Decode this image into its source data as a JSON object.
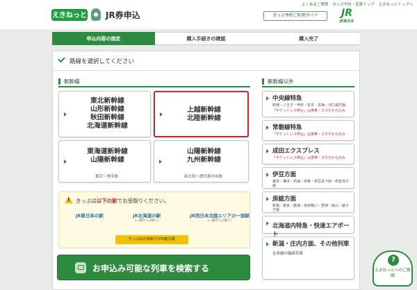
{
  "header": {
    "top_links": [
      "よくあるご質問",
      "きっぷ予約・変更トップ",
      "えきねっとトップへ"
    ],
    "logo": "えきねっと",
    "title": "JR券申込",
    "guide_button": "きっぷ予約ご利用ガイド",
    "jr_logo": "JR",
    "jr_sub": "JR東日本"
  },
  "steps": [
    "申込内容の指定",
    "購入手続きの確認",
    "購入完了"
  ],
  "route": {
    "heading": "路線を選択してください"
  },
  "shinkansen": {
    "section_title": "新幹線",
    "buttons": [
      {
        "lines": "東北新幹線\n山形新幹線\n秋田新幹線\n北海道新幹線",
        "sub": ""
      },
      {
        "lines": "上越新幹線\n北陸新幹線",
        "sub": ""
      },
      {
        "lines": "東海道新幹線\n山陽新幹線",
        "sub": "東京〜博多間"
      },
      {
        "lines": "山陽新幹線\n九州新幹線",
        "sub": "新大阪〜鹿児島中央間"
      }
    ]
  },
  "notice": {
    "text_prefix": "きっぷは",
    "text_red": "以下の駅",
    "text_suffix": "でお受取りください。",
    "stations": [
      {
        "name": "JR東日本の駅",
        "note": ""
      },
      {
        "name": "JR北海道の駅",
        "note": "（一部きっぷ除く）"
      },
      {
        "name": "JR西日本北陸エリアの一部駅",
        "note": "（一部きっぷ除く）"
      }
    ],
    "button": "きっぷのお受取りが可能な駅"
  },
  "search_button": "お申込み可能な列車を検索する",
  "other": {
    "section_title": "新幹線以外",
    "items": [
      {
        "title": "中央線特急",
        "desc": "新宿・八王子・甲府・松本・青梅・河口湖方面",
        "online": "「チケットレス申込」は携帯・スマホからのみ"
      },
      {
        "title": "常磐線特急",
        "desc": "",
        "online": "「チケットレス申込」は携帯・スマホからのみ"
      },
      {
        "title": "成田エクスプレス",
        "desc": "",
        "online": "「チケットレス申込」は携帯・スマホからのみ"
      },
      {
        "title": "伊豆方面",
        "desc": "東京・横浜・熱海・伊東・伊豆急下田・修善寺方面",
        "online": ""
      },
      {
        "title": "房総方面",
        "desc": "新宿・東京・勝浦・安房鴨川・君津・館山・銚子方面",
        "online": ""
      },
      {
        "title": "北海道内特急・快速エアポート",
        "desc": "",
        "online": ""
      },
      {
        "title": "新潟・庄内方面、その他列車",
        "desc": "在来線の臨時列車",
        "online": ""
      }
    ]
  },
  "help": {
    "label": "えきねっとへのご質問"
  }
}
